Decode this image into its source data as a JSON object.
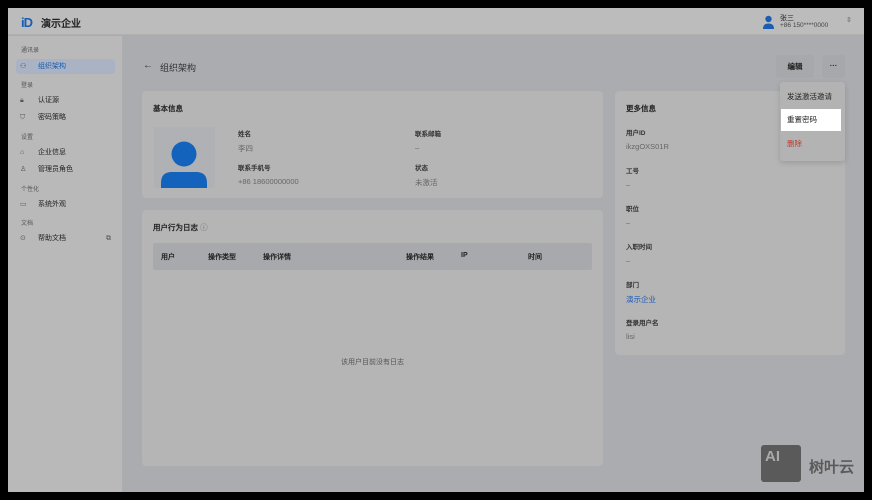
{
  "header": {
    "logo": "iD",
    "app_name": "演示企业",
    "user_name": "张三",
    "user_phone": "+86 150****0000"
  },
  "sidebar": {
    "sections": [
      "通讯录",
      "登录",
      "设置",
      "个性化",
      "文档"
    ],
    "items": [
      {
        "label": "组织架构",
        "icon": "org-icon"
      },
      {
        "label": "认证源",
        "icon": "lock-icon"
      },
      {
        "label": "密码策略",
        "icon": "shield-icon"
      },
      {
        "label": "企业信息",
        "icon": "building-icon"
      },
      {
        "label": "管理员角色",
        "icon": "admin-icon"
      },
      {
        "label": "系统外观",
        "icon": "monitor-icon"
      },
      {
        "label": "帮助文档",
        "icon": "location-icon"
      }
    ]
  },
  "page": {
    "title": "组织架构",
    "edit": "编辑",
    "more": "···"
  },
  "basic": {
    "title": "基本信息",
    "name_label": "姓名",
    "name": "李四",
    "email_label": "联系邮箱",
    "email": "–",
    "phone_label": "联系手机号",
    "phone": "+86 18600000000",
    "status_label": "状态",
    "status": "未激活"
  },
  "log": {
    "title": "用户行为日志",
    "columns": [
      "用户",
      "操作类型",
      "操作详情",
      "操作结果",
      "IP",
      "时间"
    ],
    "empty": "该用户目前没有日志"
  },
  "more_info": {
    "title": "更多信息",
    "fields": [
      {
        "label": "用户ID",
        "value": "ikzgOXS01R"
      },
      {
        "label": "工号",
        "value": "–"
      },
      {
        "label": "职位",
        "value": "–"
      },
      {
        "label": "入职时间",
        "value": "–"
      },
      {
        "label": "部门",
        "value": "演示企业"
      },
      {
        "label": "登录用户名",
        "value": "lisi"
      }
    ]
  },
  "menu": {
    "items": [
      "发送激活邀请",
      "重置密码",
      "删除"
    ]
  },
  "watermark": {
    "logo": "AI",
    "text": "树叶云"
  }
}
